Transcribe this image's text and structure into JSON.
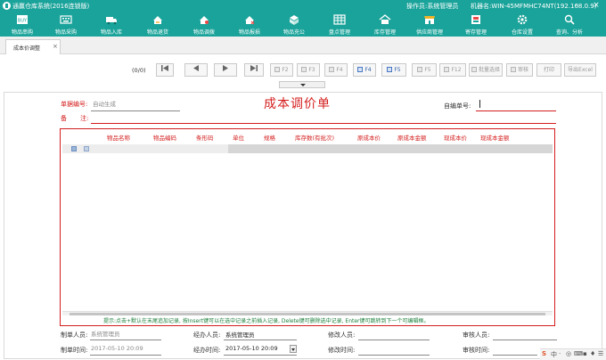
{
  "app": {
    "title": "通赢仓库系统(2016连锁版)",
    "user_info": "操作员:系统管理员",
    "machine_info": "机器名:WIN-45MFMHC74NT(192.168.0.9)"
  },
  "nav": [
    {
      "label": "物品串购",
      "icon": "buy-icon"
    },
    {
      "label": "物品采购",
      "icon": "keyboard-icon"
    },
    {
      "label": "物品入库",
      "icon": "truck-icon"
    },
    {
      "label": "物品退货",
      "icon": "return-icon"
    },
    {
      "label": "物品调拨",
      "icon": "transfer-icon"
    },
    {
      "label": "物品报损",
      "icon": "loss-icon"
    },
    {
      "label": "物品充公",
      "icon": "confiscate-icon"
    },
    {
      "label": "盘点管理",
      "icon": "inventory-icon"
    },
    {
      "label": "库存管理",
      "icon": "stock-icon"
    },
    {
      "label": "供应商管理",
      "icon": "supplier-icon"
    },
    {
      "label": "寄存管理",
      "icon": "deposit-icon"
    },
    {
      "label": "仓库设置",
      "icon": "gear-icon"
    },
    {
      "label": "查询、分析",
      "icon": "search-analyze-icon"
    }
  ],
  "tab": {
    "label": "成本价调整",
    "close": "×"
  },
  "toolbar": {
    "record_count": "(0/0)",
    "buttons": [
      "F2",
      "F3",
      "F4",
      "F5",
      "F12",
      "批量选择",
      "审核",
      "打印",
      "导出Excel"
    ]
  },
  "form": {
    "title": "成本调价单",
    "bill_no_label": "单据编号:",
    "bill_no_value": "自动生成",
    "self_no_label": "自编单号:",
    "remark_label": "备",
    "remark_label2": "注:"
  },
  "grid": {
    "columns": [
      "物品名称",
      "物品编码",
      "条形码",
      "单位",
      "规格",
      "库存数(有批次)",
      "原成本价",
      "原成本金额",
      "现成本价",
      "现成本金额"
    ],
    "hint": "提示:点击+默认在末尾追加记录, 按Insert键可以在选中记录之前插入记录, Delete键可删除选中记录, Enter键可跳转到下一个可编辑框。"
  },
  "footer": {
    "maker_label": "制单人员:",
    "maker_value": "系统管理员",
    "handler_label": "经办人员:",
    "handler_value": "系统管理员",
    "modifier_label": "修改人员:",
    "reviewer_label": "审核人员:",
    "make_time_label": "制单时间:",
    "make_time_value": "2017-05-10 20:09",
    "handle_time_label": "经办时间:",
    "handle_time_value": "2017-05-10 20:09",
    "modify_time_label": "修改时间:",
    "review_time_label": "审核时间:"
  },
  "tray": [
    "S",
    "中",
    "·",
    "◎",
    "⌨",
    "▪",
    "♦",
    "☰"
  ]
}
